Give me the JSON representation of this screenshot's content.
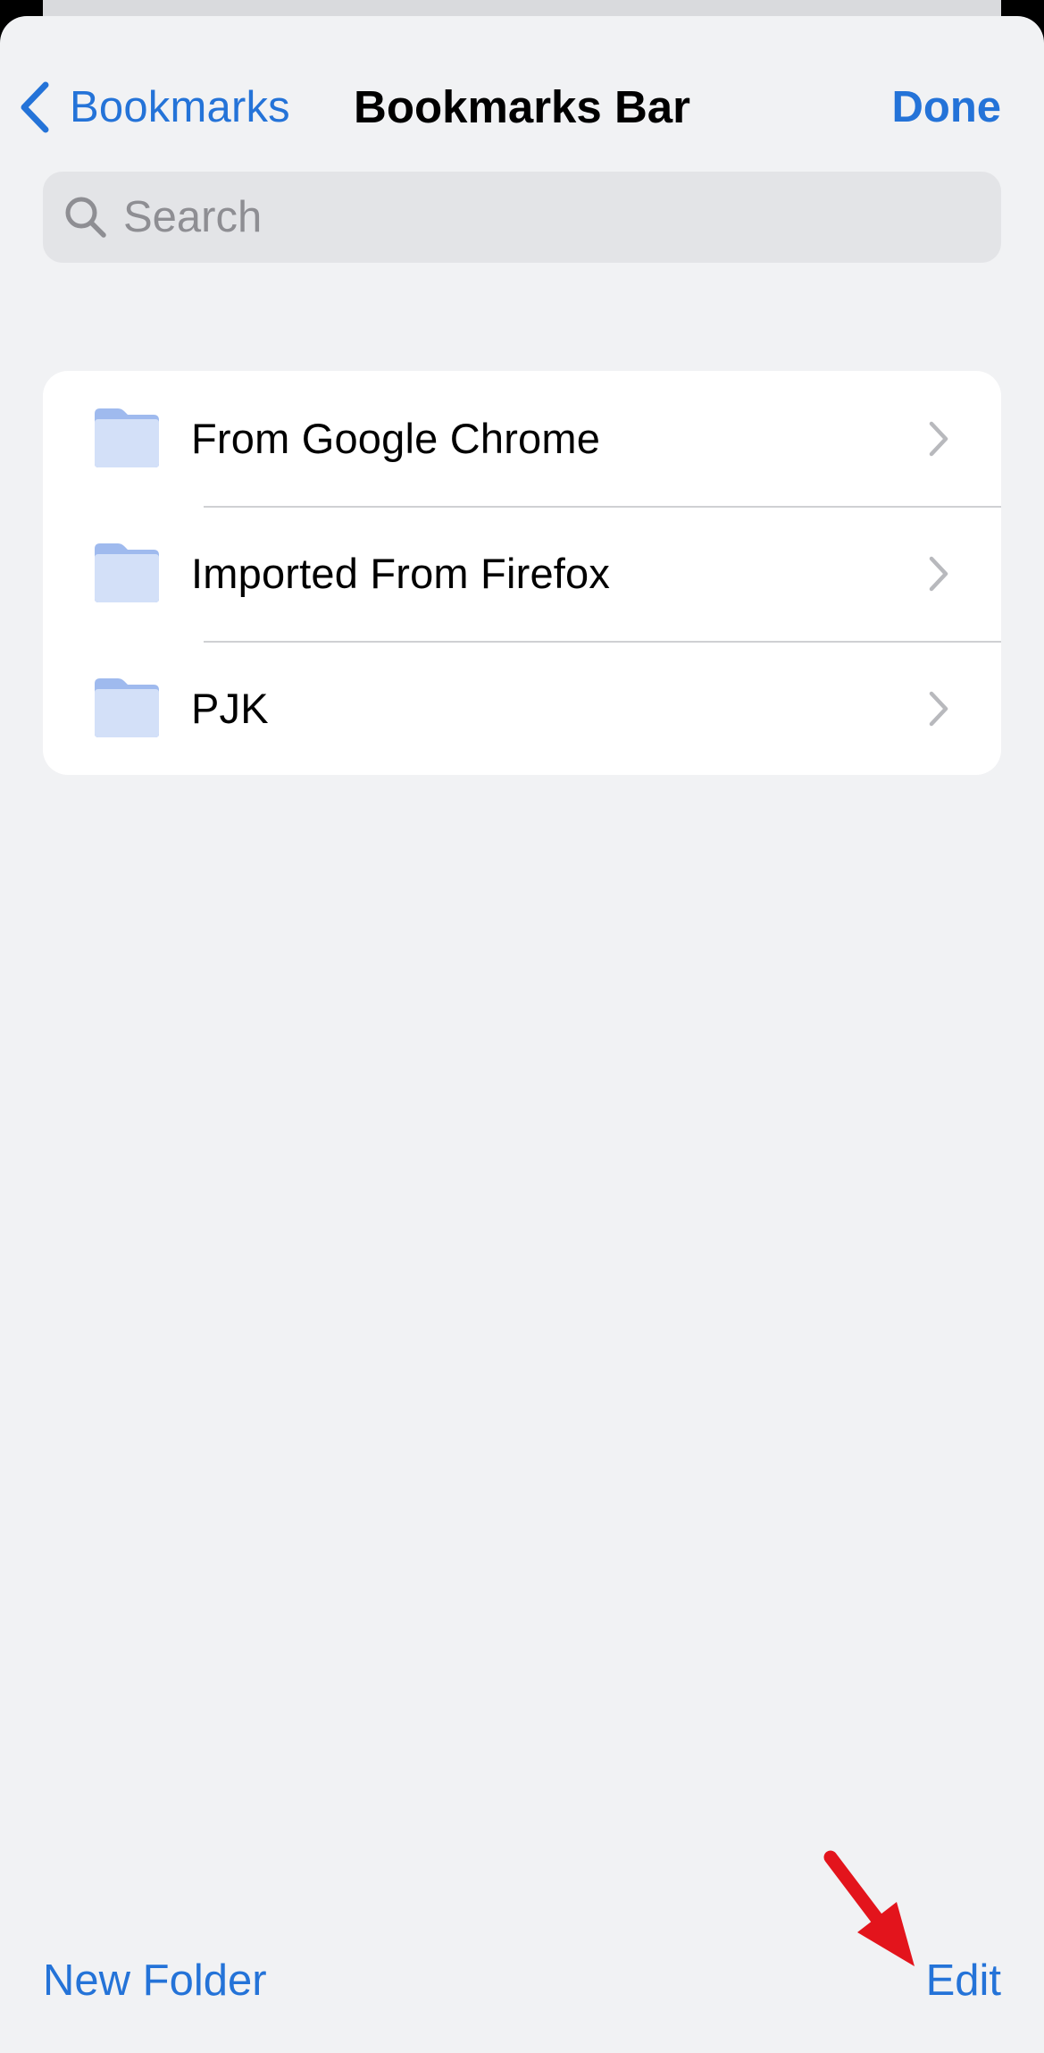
{
  "nav": {
    "back_label": "Bookmarks",
    "title": "Bookmarks Bar",
    "done_label": "Done"
  },
  "search": {
    "placeholder": "Search",
    "value": ""
  },
  "folders": [
    {
      "label": "From Google Chrome",
      "icon": "folder-icon"
    },
    {
      "label": "Imported From Firefox",
      "icon": "folder-icon"
    },
    {
      "label": "PJK",
      "icon": "folder-icon"
    }
  ],
  "toolbar": {
    "new_folder_label": "New Folder",
    "edit_label": "Edit"
  },
  "colors": {
    "accent": "#2473d8",
    "background": "#f1f2f4",
    "folder": "#aec6f1",
    "annotation": "#e3141c"
  }
}
